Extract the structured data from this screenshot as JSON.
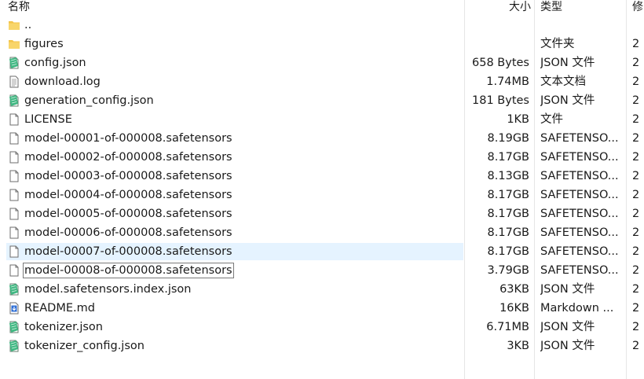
{
  "columns": {
    "name": "名称",
    "size": "大小",
    "type": "类型",
    "modified": "修"
  },
  "files": [
    {
      "name": "..",
      "size": "",
      "type": "",
      "modified": "",
      "icon": "folder-icon"
    },
    {
      "name": "figures",
      "size": "",
      "type": "文件夹",
      "modified": "2",
      "icon": "folder-icon"
    },
    {
      "name": "config.json",
      "size": "658 Bytes",
      "type": "JSON 文件",
      "modified": "2",
      "icon": "json-file-icon"
    },
    {
      "name": "download.log",
      "size": "1.74MB",
      "type": "文本文档",
      "modified": "2",
      "icon": "text-file-icon"
    },
    {
      "name": "generation_config.json",
      "size": "181 Bytes",
      "type": "JSON 文件",
      "modified": "2",
      "icon": "json-file-icon"
    },
    {
      "name": "LICENSE",
      "size": "1KB",
      "type": "文件",
      "modified": "2",
      "icon": "blank-file-icon"
    },
    {
      "name": "model-00001-of-000008.safetensors",
      "size": "8.19GB",
      "type": "SAFETENSO...",
      "modified": "2",
      "icon": "blank-file-icon"
    },
    {
      "name": "model-00002-of-000008.safetensors",
      "size": "8.17GB",
      "type": "SAFETENSO...",
      "modified": "2",
      "icon": "blank-file-icon"
    },
    {
      "name": "model-00003-of-000008.safetensors",
      "size": "8.13GB",
      "type": "SAFETENSO...",
      "modified": "2",
      "icon": "blank-file-icon"
    },
    {
      "name": "model-00004-of-000008.safetensors",
      "size": "8.17GB",
      "type": "SAFETENSO...",
      "modified": "2",
      "icon": "blank-file-icon"
    },
    {
      "name": "model-00005-of-000008.safetensors",
      "size": "8.17GB",
      "type": "SAFETENSO...",
      "modified": "2",
      "icon": "blank-file-icon"
    },
    {
      "name": "model-00006-of-000008.safetensors",
      "size": "8.17GB",
      "type": "SAFETENSO...",
      "modified": "2",
      "icon": "blank-file-icon"
    },
    {
      "name": "model-00007-of-000008.safetensors",
      "size": "8.17GB",
      "type": "SAFETENSO...",
      "modified": "2",
      "icon": "blank-file-icon"
    },
    {
      "name": "model-00008-of-000008.safetensors",
      "size": "3.79GB",
      "type": "SAFETENSO...",
      "modified": "2",
      "icon": "blank-file-icon"
    },
    {
      "name": "model.safetensors.index.json",
      "size": "63KB",
      "type": "JSON 文件",
      "modified": "2",
      "icon": "json-file-icon"
    },
    {
      "name": "README.md",
      "size": "16KB",
      "type": "Markdown ...",
      "modified": "2",
      "icon": "markdown-file-icon"
    },
    {
      "name": "tokenizer.json",
      "size": "6.71MB",
      "type": "JSON 文件",
      "modified": "2",
      "icon": "json-file-icon"
    },
    {
      "name": "tokenizer_config.json",
      "size": "3KB",
      "type": "JSON 文件",
      "modified": "2",
      "icon": "json-file-icon"
    }
  ],
  "hover_row": 12,
  "selected_row": 13,
  "colors": {
    "hover": "#e5f3ff",
    "folder": "#f5c542",
    "json": "#3cb371"
  }
}
